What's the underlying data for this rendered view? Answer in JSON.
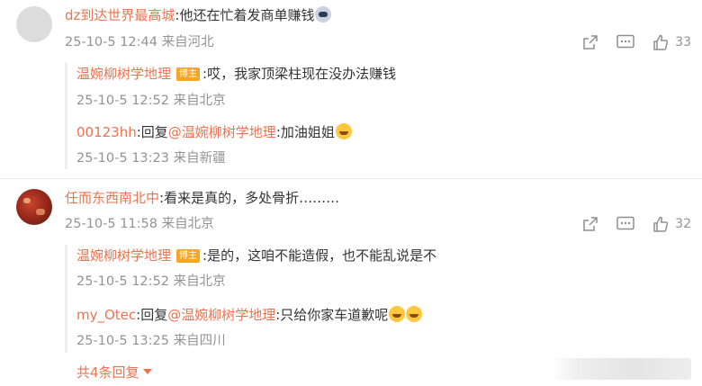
{
  "comments": [
    {
      "author": "dz到达世界最高城",
      "text": ":他还在忙着发商单赚钱",
      "time": "25-10-5 12:44 来自河北",
      "likes": "33",
      "replies": [
        {
          "author": "温婉柳树学地理",
          "badge": "博主",
          "text": ":哎，我家顶梁柱现在没办法赚钱",
          "time": "25-10-5 12:52 来自北京"
        },
        {
          "author": "00123hh",
          "prefix": ":回复",
          "mention": "@温婉柳树学地理",
          "text": ":加油姐姐",
          "time": "25-10-5 13:23 来自新疆"
        }
      ]
    },
    {
      "author": "任而东西南北中",
      "text": ":看来是真的，多处骨折………",
      "time": "25-10-5 11:58 来自北京",
      "likes": "32",
      "replies": [
        {
          "author": "温婉柳树学地理",
          "badge": "博主",
          "text": ":是的，这咱不能造假，也不能乱说是不",
          "time": "25-10-5 12:52 来自北京"
        },
        {
          "author": "my_Otec",
          "prefix": ":回复",
          "mention": "@温婉柳树学地理",
          "text": ":只给你家车道歉呢",
          "time": "25-10-5 13:25 来自四川"
        }
      ],
      "more_label": "共4条回复"
    }
  ],
  "icons": {
    "share": "share-icon",
    "comment": "comment-icon",
    "like": "like-icon",
    "emoji_mask": "mask-face-emoji-icon",
    "emoji_hug": "hugging-face-emoji-icon",
    "emoji_laugh": "laughing-tears-emoji-icon"
  },
  "colors": {
    "accent": "#eb7350",
    "meta": "#939393",
    "badge": "#f5a623"
  }
}
